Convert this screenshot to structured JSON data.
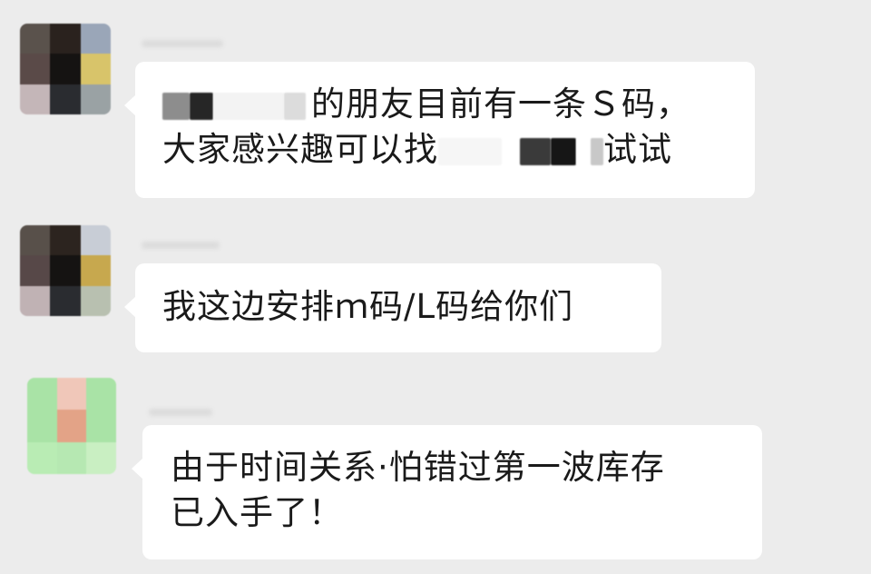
{
  "messages": [
    {
      "lines": [
        {
          "text": "的朋友目前有一条Ｓ码，"
        },
        {
          "text": "大家感兴趣可以找"
        },
        {
          "text": "试试"
        }
      ]
    },
    {
      "lines": [
        {
          "text": "我这边安排ｍ码/L码给你们"
        }
      ]
    },
    {
      "lines": [
        {
          "text": "由于时间关系·怕错过第一波库存"
        },
        {
          "text": "已入手了！"
        }
      ]
    }
  ],
  "avatar_colors": {
    "a1": [
      "#5a524c",
      "#2a221e",
      "#9aa6b8",
      "#5a4a48",
      "#151312",
      "#d8c46a",
      "#c4b6b8",
      "#2a2c30",
      "#9aa2a4"
    ],
    "a2": [
      "#58504a",
      "#2c241f",
      "#c8cdd6",
      "#574848",
      "#151312",
      "#c7a84e",
      "#c0b2b4",
      "#2a2c30",
      "#b8c0b0"
    ],
    "a3": [
      "#a9e3a6",
      "#f0c7b9",
      "#a9e3a6",
      "#a9e3a6",
      "#e3a387",
      "#a9e3a6",
      "#b9ecb4",
      "#b6e8b2",
      "#c9efc2"
    ]
  },
  "colors": {
    "background": "#ececec",
    "bubble": "#ffffff",
    "text": "#1a1a1a"
  }
}
